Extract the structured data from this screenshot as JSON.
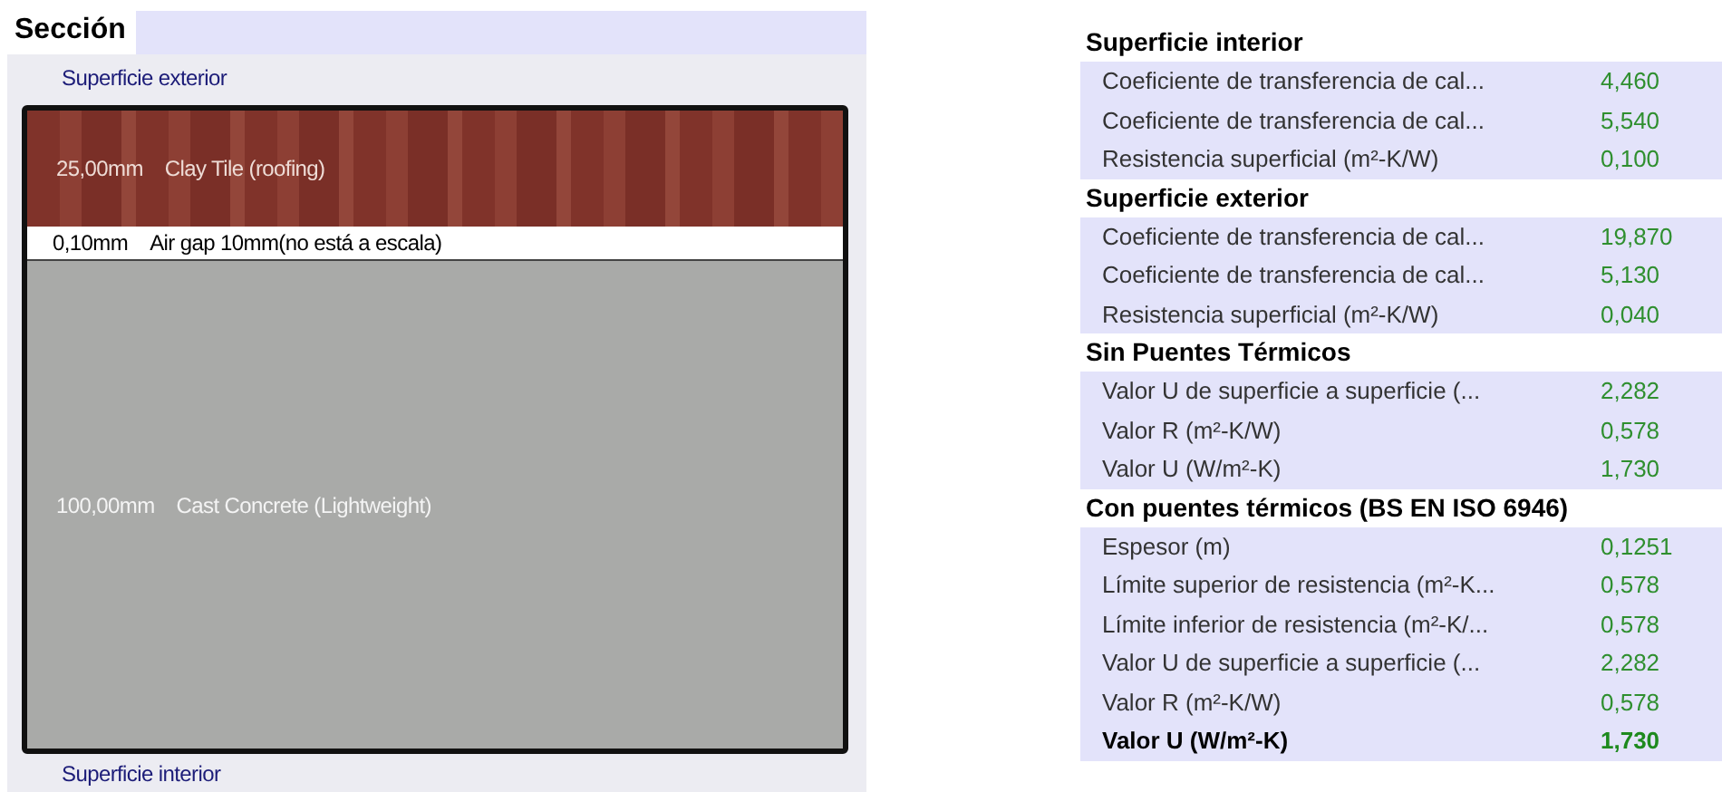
{
  "section": {
    "title": "Sección",
    "top_label": "Superficie exterior",
    "bottom_label": "Superficie interior",
    "layers": [
      {
        "kind": "tile",
        "thickness": "25,00mm",
        "material": "Clay Tile (roofing)"
      },
      {
        "kind": "air",
        "thickness": "0,10mm",
        "material": "Air gap 10mm(no está a escala)"
      },
      {
        "kind": "concrete",
        "thickness": "100,00mm",
        "material": "Cast Concrete (Lightweight)"
      }
    ]
  },
  "properties": [
    {
      "title": "Superficie interior",
      "rows": [
        {
          "label": "Coeficiente de transferencia de cal...",
          "value": "4,460",
          "emphasis": false
        },
        {
          "label": "Coeficiente de transferencia de cal...",
          "value": "5,540",
          "emphasis": false
        },
        {
          "label": "Resistencia superficial (m²-K/W)",
          "value": "0,100",
          "emphasis": false
        }
      ]
    },
    {
      "title": "Superficie exterior",
      "rows": [
        {
          "label": "Coeficiente de transferencia de cal...",
          "value": "19,870",
          "emphasis": false
        },
        {
          "label": "Coeficiente de transferencia de cal...",
          "value": "5,130",
          "emphasis": false
        },
        {
          "label": "Resistencia superficial (m²-K/W)",
          "value": "0,040",
          "emphasis": false
        }
      ]
    },
    {
      "title": "Sin Puentes Térmicos",
      "rows": [
        {
          "label": "Valor U de superficie a superficie (...",
          "value": "2,282",
          "emphasis": false
        },
        {
          "label": "Valor R (m²-K/W)",
          "value": "0,578",
          "emphasis": false
        },
        {
          "label": "Valor U (W/m²-K)",
          "value": "1,730",
          "emphasis": false
        }
      ]
    },
    {
      "title": "Con puentes térmicos (BS EN ISO 6946)",
      "rows": [
        {
          "label": "Espesor (m)",
          "value": "0,1251",
          "emphasis": false
        },
        {
          "label": "Límite superior de resistencia (m²-K...",
          "value": "0,578",
          "emphasis": false
        },
        {
          "label": "Límite inferior de resistencia (m²-K/...",
          "value": "0,578",
          "emphasis": false
        },
        {
          "label": "Valor U de superficie a superficie (...",
          "value": "2,282",
          "emphasis": false
        },
        {
          "label": "Valor R (m²-K/W)",
          "value": "0,578",
          "emphasis": false
        },
        {
          "label": "Valor U (W/m²-K)",
          "value": "1,730",
          "emphasis": true
        }
      ]
    }
  ]
}
